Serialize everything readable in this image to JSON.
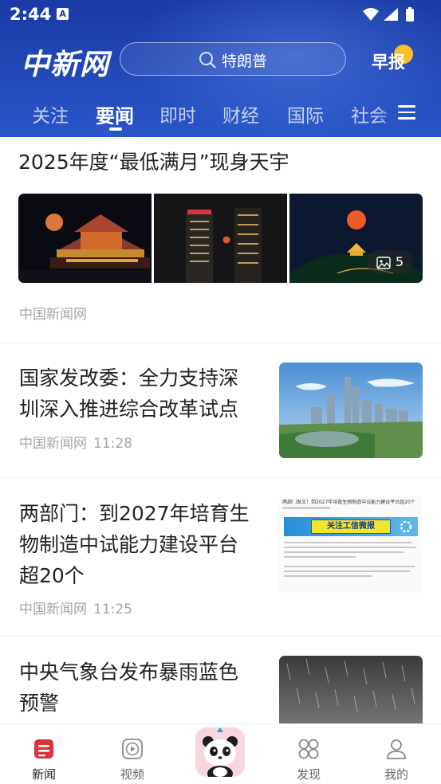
{
  "status_bar": {
    "time": "2:44",
    "notification_letter": "A"
  },
  "header": {
    "logo_text": "中新网",
    "search_placeholder": "特朗普",
    "morning_report_label": "早报"
  },
  "tabs": [
    {
      "label": "关注",
      "active": false
    },
    {
      "label": "要闻",
      "active": true
    },
    {
      "label": "即时",
      "active": false
    },
    {
      "label": "财经",
      "active": false
    },
    {
      "label": "国际",
      "active": false
    },
    {
      "label": "社会",
      "active": false
    }
  ],
  "feed": [
    {
      "type": "gallery",
      "title": "2025年度“最低满月”现身天宇",
      "source": "中国新闻网",
      "image_count": "5",
      "images": [
        "moon-over-pavilion",
        "moon-between-skyscrapers",
        "moon-over-hill-pagoda"
      ]
    },
    {
      "type": "thumb",
      "title_lines": [
        "国家发改委：全力支持深",
        "圳深入推进综合改革试点"
      ],
      "source": "中国新闻网",
      "time": "11:28",
      "image": "shenzhen-skyline"
    },
    {
      "type": "thumb",
      "title_lines": [
        "两部门：到2027年培育生",
        "物制造中试能力建设平台",
        "超20个"
      ],
      "source": "中国新闻网",
      "time": "11:25",
      "image": "document-screenshot",
      "image_text": {
        "title": "两部门发文！到2027年培育生物制造中试能力建设平台超20个",
        "banner": "关注工信微报"
      }
    },
    {
      "type": "thumb",
      "title_lines": [
        "中央气象台发布暴雨蓝色",
        "预警"
      ],
      "image": "heavy-rain"
    }
  ],
  "bottom_nav": [
    {
      "label": "新闻",
      "icon": "news-icon",
      "active": true
    },
    {
      "label": "视频",
      "icon": "video-icon",
      "active": false
    },
    {
      "label": "",
      "icon": "panda-mascot-icon",
      "active": false
    },
    {
      "label": "发现",
      "icon": "discover-icon",
      "active": false
    },
    {
      "label": "我的",
      "icon": "profile-icon",
      "active": false
    }
  ],
  "colors": {
    "header_blue": "#1f44b5",
    "accent_red": "#d9343a",
    "sun_yellow": "#f8c12a"
  }
}
